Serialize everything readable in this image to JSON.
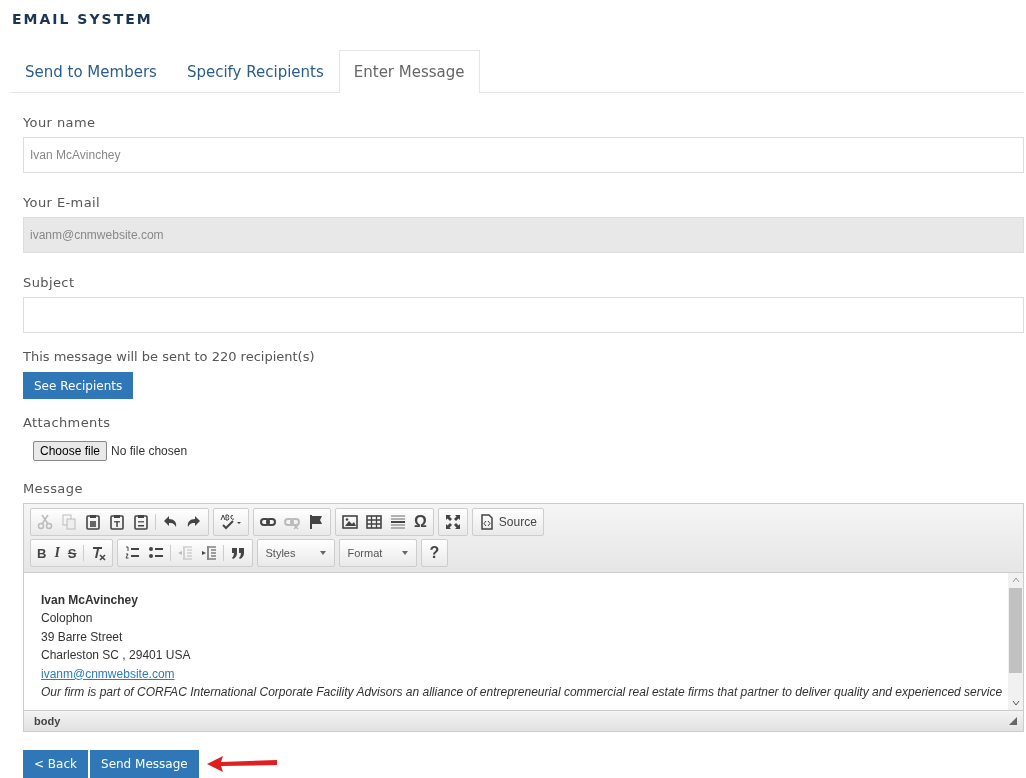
{
  "title": "EMAIL SYSTEM",
  "tabs": [
    {
      "label": "Send to Members",
      "selected": false
    },
    {
      "label": "Specify Recipients",
      "selected": false
    },
    {
      "label": "Enter Message",
      "selected": true
    }
  ],
  "fields": [
    {
      "label": "Your name",
      "value": "Ivan McAvinchey",
      "disabled": false
    },
    {
      "label": "Your E-mail",
      "value": "ivanm@cnmwebsite.com",
      "disabled": true
    },
    {
      "label": "Subject",
      "disabled": false
    }
  ],
  "recipients_note": "This message will be sent to 220 recipient(s)",
  "see_recipients_button": "See Recipients",
  "attachments": {
    "label": "Attachments",
    "button": "Choose file",
    "status": "No file chosen"
  },
  "message": {
    "label": "Message",
    "toolbar": [
      [
        [
          {
            "kind": "cut",
            "disabled": true
          },
          {
            "kind": "copy",
            "disabled": true
          },
          {
            "kind": "paste",
            "disabled": false
          },
          {
            "kind": "paste-text",
            "disabled": false
          },
          {
            "kind": "paste-word",
            "disabled": false
          },
          {
            "kind": "separator"
          },
          {
            "kind": "undo",
            "disabled": false
          },
          {
            "kind": "redo",
            "disabled": false
          }
        ],
        [
          {
            "kind": "spellcheck",
            "disabled": false
          }
        ],
        [
          {
            "kind": "link",
            "disabled": false
          },
          {
            "kind": "unlink",
            "disabled": true
          },
          {
            "kind": "anchor",
            "disabled": false
          }
        ],
        [
          {
            "kind": "image",
            "disabled": false
          },
          {
            "kind": "table",
            "disabled": false
          },
          {
            "kind": "rule",
            "disabled": false
          },
          {
            "kind": "char",
            "label": "Ω",
            "disabled": false
          }
        ],
        [
          {
            "kind": "maximize",
            "disabled": false
          }
        ],
        [
          {
            "kind": "source",
            "label": "Source",
            "disabled": false
          }
        ]
      ],
      [
        [
          {
            "kind": "bold",
            "label": "B",
            "disabled": false
          },
          {
            "kind": "italic",
            "label": "I",
            "disabled": false
          },
          {
            "kind": "strike",
            "label": "S",
            "disabled": false
          },
          {
            "kind": "separator"
          },
          {
            "kind": "clear-format",
            "disabled": false
          }
        ],
        [
          {
            "kind": "numbered-list",
            "disabled": false
          },
          {
            "kind": "bullet-list",
            "disabled": false
          },
          {
            "kind": "separator"
          },
          {
            "kind": "outdent",
            "disabled": true
          },
          {
            "kind": "indent",
            "disabled": false
          },
          {
            "kind": "separator"
          },
          {
            "kind": "quote",
            "disabled": false
          }
        ],
        [
          {
            "kind": "combo",
            "label": "Styles",
            "disabled": false
          }
        ],
        [
          {
            "kind": "combo",
            "label": "Format",
            "disabled": false
          }
        ],
        [
          {
            "kind": "help",
            "label": "?",
            "disabled": false
          }
        ]
      ]
    ],
    "lines": [
      {
        "kind": "bold",
        "text": "Ivan McAvinchey"
      },
      {
        "kind": "plain",
        "text": "Colophon"
      },
      {
        "kind": "plain",
        "text": "39 Barre Street"
      },
      {
        "kind": "plain",
        "text": "Charleston SC , 29401 USA"
      },
      {
        "kind": "link",
        "text": "ivanm@cnmwebsite.com"
      },
      {
        "kind": "italic",
        "text": "Our firm is part of CORFAC International Corporate Facility Advisors an alliance of entrepreneurial commercial real estate firms that partner to deliver quality and experienced service"
      }
    ],
    "path": "body"
  },
  "buttons": [
    "< Back",
    "Send Message"
  ]
}
